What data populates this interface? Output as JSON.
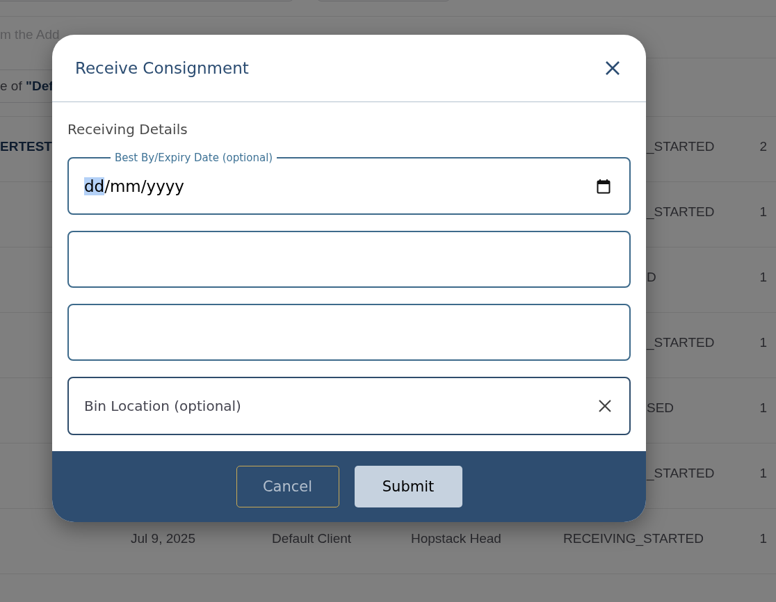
{
  "page": {
    "hint": "m the Add",
    "notice": "e of **\"Def**"
  },
  "table": {
    "rows": [
      {
        "column_1": "ERTEST",
        "column_5": "_STARTED",
        "column_6": "2"
      },
      {
        "column_5": "_STARTED",
        "column_6": "1"
      },
      {
        "column_5": "D",
        "column_6": "1"
      },
      {
        "column_5": "_STARTED",
        "column_6": "1"
      },
      {
        "column_5": "SED",
        "column_6": "1"
      },
      {
        "column_5": "_STARTED",
        "column_6": "1"
      },
      {
        "column_2": "Jul 9, 2025",
        "column_3": "Default Client",
        "column_4": "Hopstack Head",
        "column_5": "RECEIVING_STARTED",
        "column_6": "1"
      }
    ]
  },
  "dialog": {
    "title": "Receive Consignment",
    "section": "Receiving Details",
    "fields": [
      {
        "kind": "date",
        "label": "Best By/Expiry Date (optional)",
        "separator": "/",
        "segments": [
          {
            "text": "dd",
            "selected": true
          },
          {
            "text": "mm",
            "selected": false
          },
          {
            "text": "yyyy",
            "selected": false
          }
        ]
      },
      {
        "kind": "text"
      },
      {
        "kind": "text"
      },
      {
        "kind": "clearable",
        "placeholder": "Bin Location (optional)"
      }
    ],
    "buttons": [
      {
        "label": "Cancel",
        "kind": "secondary"
      },
      {
        "label": "Submit",
        "kind": "primary"
      }
    ]
  }
}
